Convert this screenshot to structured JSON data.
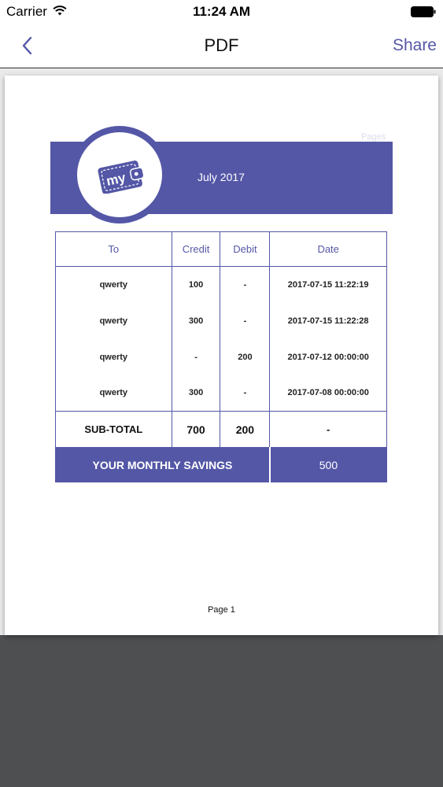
{
  "status_bar": {
    "carrier": "Carrier",
    "time": "11:24 AM"
  },
  "nav": {
    "title": "PDF",
    "share_label": "Share"
  },
  "document": {
    "pages_label": "Pages",
    "logo_text": "my",
    "month": "July 2017",
    "page_number": "Page 1",
    "accent_color": "#5457a6",
    "table": {
      "headers": [
        "To",
        "Credit",
        "Debit",
        "Date"
      ],
      "rows": [
        {
          "to": "qwerty",
          "credit": "100",
          "debit": "-",
          "date": "2017-07-15 11:22:19"
        },
        {
          "to": "qwerty",
          "credit": "300",
          "debit": "-",
          "date": "2017-07-15 11:22:28"
        },
        {
          "to": "qwerty",
          "credit": "-",
          "debit": "200",
          "date": "2017-07-12 00:00:00"
        },
        {
          "to": "qwerty",
          "credit": "300",
          "debit": "-",
          "date": "2017-07-08 00:00:00"
        }
      ],
      "subtotal": {
        "label": "SUB-TOTAL",
        "credit": "700",
        "debit": "200",
        "date": "-"
      },
      "savings": {
        "label": "YOUR MONTHLY SAVINGS",
        "value": "500"
      }
    }
  }
}
